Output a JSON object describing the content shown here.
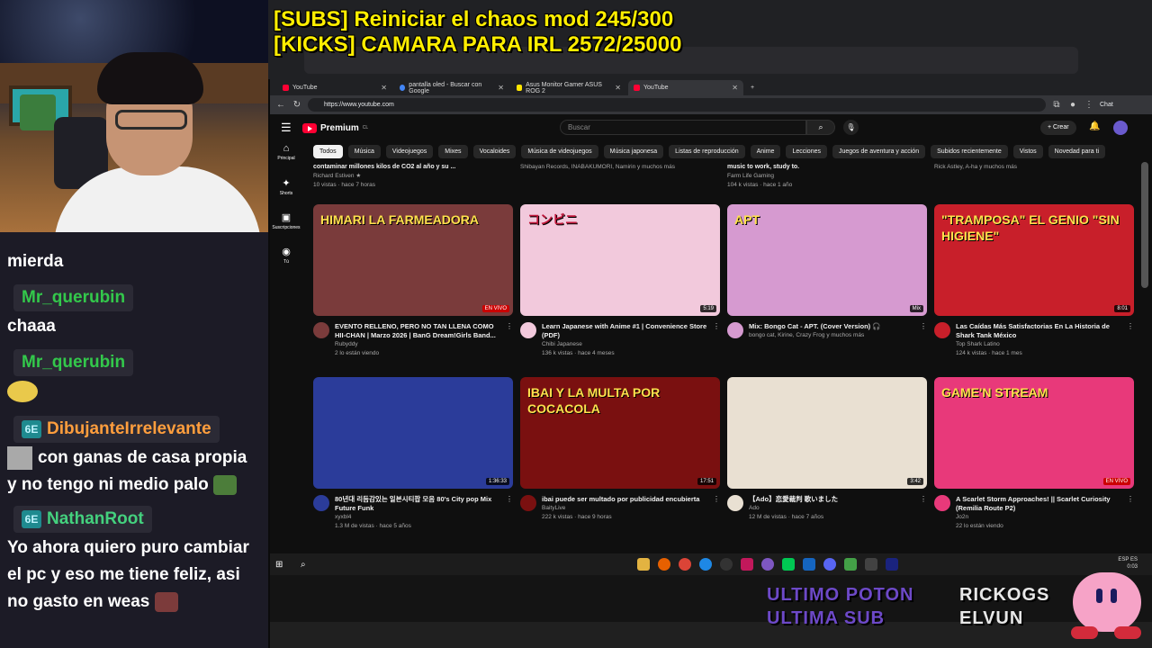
{
  "overlay": {
    "line1": "[SUBS] Reiniciar el chaos mod 245/300",
    "line2": "[KICKS] CAMARA PARA IRL 2572/25000"
  },
  "chat": {
    "messages": [
      {
        "type": "text",
        "text": "mierda"
      },
      {
        "type": "user",
        "name": "Mr_querubin"
      },
      {
        "type": "text",
        "text": "chaaa"
      },
      {
        "type": "user",
        "name": "Mr_querubin"
      },
      {
        "type": "user",
        "name": "DibujanteIrrelevante",
        "badge": "6E"
      },
      {
        "type": "text",
        "text": "con ganas de casa propia"
      },
      {
        "type": "text",
        "text": "y no tengo ni medio palo"
      },
      {
        "type": "user",
        "name": "NathanRoot",
        "badge": "6E"
      },
      {
        "type": "text",
        "text": "Yo ahora quiero puro cambiar"
      },
      {
        "type": "text",
        "text": "el pc y eso me tiene feliz, asi"
      },
      {
        "type": "text",
        "text": "no gasto en weas"
      }
    ]
  },
  "browser": {
    "tabs": [
      {
        "label": "YouTube"
      },
      {
        "label": "pantalla oled - Buscar con Google"
      },
      {
        "label": "Asus Monitor Gamer ASUS ROG 2"
      },
      {
        "label": "YouTube"
      }
    ],
    "url": "https://www.youtube.com",
    "chat_label": "Chat"
  },
  "youtube": {
    "logo": "Premium",
    "logo_region": "CL",
    "search_placeholder": "Buscar",
    "create_label": "Crear",
    "sidebar": [
      {
        "label": "Principal",
        "icon": "home-icon",
        "glyph": "⌂"
      },
      {
        "label": "Shorts",
        "icon": "shorts-icon",
        "glyph": "✦"
      },
      {
        "label": "Suscripciones",
        "icon": "subscriptions-icon",
        "glyph": "▣"
      },
      {
        "label": "Tú",
        "icon": "user-icon",
        "glyph": "◉"
      }
    ],
    "chips": [
      "Todos",
      "Música",
      "Videojuegos",
      "Mixes",
      "Vocaloides",
      "Música de videojuegos",
      "Música japonesa",
      "Listas de reproducción",
      "Anime",
      "Lecciones",
      "Juegos de aventura y acción",
      "Subidos recientemente",
      "Vistos",
      "Novedad para ti"
    ],
    "top_row": [
      {
        "title": "contaminar millones kilos de CO2 al año y su ...",
        "channel": "Richard Estiven ★",
        "stats": "10 vistas · hace 7 horas"
      },
      {
        "title": "",
        "channel": "Shibayan Records, INABAKUMORI, Namirin y muchos más",
        "stats": ""
      },
      {
        "title": "music to work, study to.",
        "channel": "Farm Life Gaming",
        "stats": "104 k vistas · hace 1 año"
      },
      {
        "title": "",
        "channel": "Rick Astley, A-ha y muchos más",
        "stats": ""
      }
    ],
    "row1": [
      {
        "title": "EVENTO RELLENO, PERO NO TAN LLENA COMO HII-CHAN | Marzo 2026 | BanG Dream!Girls Band...",
        "channel": "Rubyddy",
        "stats": "2 lo están viendo",
        "badge": "EN VIVO",
        "thumb_text": "HIMARI LA FARMEADORA",
        "thumb_color": "#7a3b3b"
      },
      {
        "title": "Learn Japanese with Anime #1 | Convenience Store (PDF)",
        "channel": "Chibi Japanese",
        "stats": "136 k vistas · hace 4 meses",
        "badge": "5:19",
        "thumb_text": "コンビニ",
        "thumb_color": "#f2c9dc"
      },
      {
        "title": "Mix: Bongo Cat - APT. (Cover Version) 🎧",
        "channel": "bongo cat, Kirine, Crazy Frog y muchos más",
        "stats": "",
        "badge": "Mix",
        "thumb_text": "APT",
        "thumb_color": "#d69ad0"
      },
      {
        "title": "Las Caídas Más Satisfactorias En La Historia de Shark Tank México",
        "channel": "Top Shark Latino",
        "stats": "124 k vistas · hace 1 mes",
        "badge": "8:01",
        "thumb_text": "\"TRAMPOSA\"  EL GENIO  \"SIN HIGIENE\"",
        "thumb_color": "#c81f2a"
      }
    ],
    "row2": [
      {
        "title": "80년대 리듬감있는 일본시티팝 모음 80's City pop Mix Future Funk",
        "channel": "xyxbl4",
        "stats": "1.3 M de vistas · hace 5 años",
        "badge": "1:36:33",
        "thumb_text": "",
        "thumb_color": "#2b3c9a"
      },
      {
        "title": "ibai puede ser multado por publicidad encubierta",
        "channel": "BaityLive",
        "stats": "222 k vistas · hace 9 horas",
        "badge": "17:51",
        "thumb_text": "IBAI Y LA MULTA POR COCACOLA",
        "thumb_color": "#7a1010"
      },
      {
        "title": "【Ado】恋愛裁判 歌いました",
        "channel": "Ado",
        "stats": "12 M de vistas · hace 7 años",
        "badge": "3:42",
        "thumb_text": "",
        "thumb_color": "#e9e0d2"
      },
      {
        "title": "A Scarlet Storm Approaches! || Scarlet Curiosity (Remilia Route P2)",
        "channel": "Jo2n",
        "stats": "22 lo están viendo",
        "badge": "EN VIVO",
        "thumb_text": "GAME'N STREAM",
        "thumb_color": "#e8397a"
      }
    ]
  },
  "taskbar": {
    "tray_lang": "ESP ES",
    "tray_time": "0:03"
  },
  "bottom": {
    "goal_line1": "ULTIMO POTON",
    "goal_line2": "ULTIMA SUB",
    "streamer_line1": "RICKOGS",
    "streamer_line2": "ELVUN"
  }
}
